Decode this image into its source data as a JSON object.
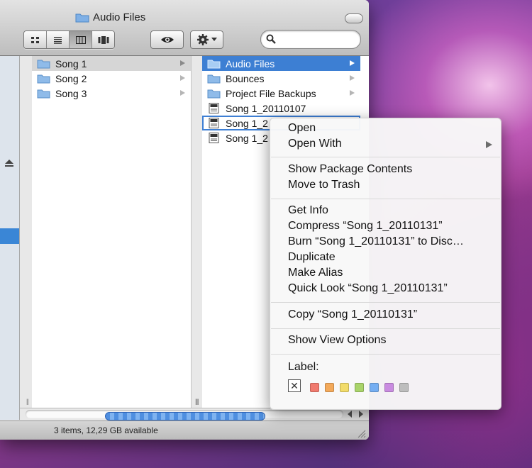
{
  "window": {
    "title": "Audio Files",
    "status_text": "3 items, 12,29 GB available",
    "search_placeholder": ""
  },
  "toolbar": {
    "view_buttons": [
      "icon-view",
      "list-view",
      "column-view",
      "coverflow-view"
    ],
    "selected_view": "column-view",
    "quicklook_icon": "eye-icon",
    "action_icon": "gear-icon"
  },
  "columns": [
    {
      "items": [
        {
          "label": "Song 1",
          "type": "folder",
          "state": "selected-inactive"
        },
        {
          "label": "Song 2",
          "type": "folder",
          "state": ""
        },
        {
          "label": "Song 3",
          "type": "folder",
          "state": ""
        }
      ]
    },
    {
      "items": [
        {
          "label": "Audio Files",
          "type": "folder",
          "state": "selected"
        },
        {
          "label": "Bounces",
          "type": "folder",
          "state": ""
        },
        {
          "label": "Project File Backups",
          "type": "folder",
          "state": ""
        },
        {
          "label": "Song 1_20110107",
          "type": "project",
          "state": ""
        },
        {
          "label": "Song 1_2",
          "type": "project",
          "state": "context-target"
        },
        {
          "label": "Song 1_2",
          "type": "project",
          "state": ""
        }
      ]
    }
  ],
  "context_menu": {
    "groups": [
      [
        "Open",
        "Open With"
      ],
      [
        "Show Package Contents",
        "Move to Trash"
      ],
      [
        "Get Info",
        "Compress “Song 1_20110131”",
        "Burn “Song 1_20110131” to Disc…",
        "Duplicate",
        "Make Alias",
        "Quick Look “Song 1_20110131”"
      ],
      [
        "Copy “Song 1_20110131”"
      ],
      [
        "Show View Options"
      ]
    ],
    "label_heading": "Label:",
    "label_none": "✕",
    "label_colors": [
      "#f07a6e",
      "#f3a95a",
      "#f2dc6a",
      "#a9d46a",
      "#75aef2",
      "#c98be0",
      "#bdbdbd"
    ]
  }
}
